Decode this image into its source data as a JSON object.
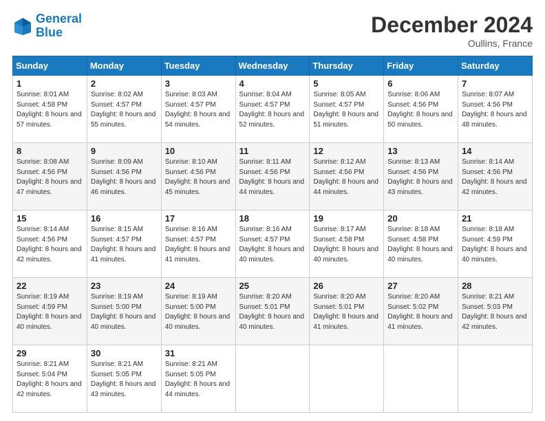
{
  "header": {
    "logo_line1": "General",
    "logo_line2": "Blue",
    "month": "December 2024",
    "location": "Oullins, France"
  },
  "weekdays": [
    "Sunday",
    "Monday",
    "Tuesday",
    "Wednesday",
    "Thursday",
    "Friday",
    "Saturday"
  ],
  "weeks": [
    [
      {
        "day": "1",
        "sunrise": "8:01 AM",
        "sunset": "4:58 PM",
        "daylight": "8 hours and 57 minutes."
      },
      {
        "day": "2",
        "sunrise": "8:02 AM",
        "sunset": "4:57 PM",
        "daylight": "8 hours and 55 minutes."
      },
      {
        "day": "3",
        "sunrise": "8:03 AM",
        "sunset": "4:57 PM",
        "daylight": "8 hours and 54 minutes."
      },
      {
        "day": "4",
        "sunrise": "8:04 AM",
        "sunset": "4:57 PM",
        "daylight": "8 hours and 52 minutes."
      },
      {
        "day": "5",
        "sunrise": "8:05 AM",
        "sunset": "4:57 PM",
        "daylight": "8 hours and 51 minutes."
      },
      {
        "day": "6",
        "sunrise": "8:06 AM",
        "sunset": "4:56 PM",
        "daylight": "8 hours and 50 minutes."
      },
      {
        "day": "7",
        "sunrise": "8:07 AM",
        "sunset": "4:56 PM",
        "daylight": "8 hours and 48 minutes."
      }
    ],
    [
      {
        "day": "8",
        "sunrise": "8:08 AM",
        "sunset": "4:56 PM",
        "daylight": "8 hours and 47 minutes."
      },
      {
        "day": "9",
        "sunrise": "8:09 AM",
        "sunset": "4:56 PM",
        "daylight": "8 hours and 46 minutes."
      },
      {
        "day": "10",
        "sunrise": "8:10 AM",
        "sunset": "4:56 PM",
        "daylight": "8 hours and 45 minutes."
      },
      {
        "day": "11",
        "sunrise": "8:11 AM",
        "sunset": "4:56 PM",
        "daylight": "8 hours and 44 minutes."
      },
      {
        "day": "12",
        "sunrise": "8:12 AM",
        "sunset": "4:56 PM",
        "daylight": "8 hours and 44 minutes."
      },
      {
        "day": "13",
        "sunrise": "8:13 AM",
        "sunset": "4:56 PM",
        "daylight": "8 hours and 43 minutes."
      },
      {
        "day": "14",
        "sunrise": "8:14 AM",
        "sunset": "4:56 PM",
        "daylight": "8 hours and 42 minutes."
      }
    ],
    [
      {
        "day": "15",
        "sunrise": "8:14 AM",
        "sunset": "4:56 PM",
        "daylight": "8 hours and 42 minutes."
      },
      {
        "day": "16",
        "sunrise": "8:15 AM",
        "sunset": "4:57 PM",
        "daylight": "8 hours and 41 minutes."
      },
      {
        "day": "17",
        "sunrise": "8:16 AM",
        "sunset": "4:57 PM",
        "daylight": "8 hours and 41 minutes."
      },
      {
        "day": "18",
        "sunrise": "8:16 AM",
        "sunset": "4:57 PM",
        "daylight": "8 hours and 40 minutes."
      },
      {
        "day": "19",
        "sunrise": "8:17 AM",
        "sunset": "4:58 PM",
        "daylight": "8 hours and 40 minutes."
      },
      {
        "day": "20",
        "sunrise": "8:18 AM",
        "sunset": "4:58 PM",
        "daylight": "8 hours and 40 minutes."
      },
      {
        "day": "21",
        "sunrise": "8:18 AM",
        "sunset": "4:59 PM",
        "daylight": "8 hours and 40 minutes."
      }
    ],
    [
      {
        "day": "22",
        "sunrise": "8:19 AM",
        "sunset": "4:59 PM",
        "daylight": "8 hours and 40 minutes."
      },
      {
        "day": "23",
        "sunrise": "8:19 AM",
        "sunset": "5:00 PM",
        "daylight": "8 hours and 40 minutes."
      },
      {
        "day": "24",
        "sunrise": "8:19 AM",
        "sunset": "5:00 PM",
        "daylight": "8 hours and 40 minutes."
      },
      {
        "day": "25",
        "sunrise": "8:20 AM",
        "sunset": "5:01 PM",
        "daylight": "8 hours and 40 minutes."
      },
      {
        "day": "26",
        "sunrise": "8:20 AM",
        "sunset": "5:01 PM",
        "daylight": "8 hours and 41 minutes."
      },
      {
        "day": "27",
        "sunrise": "8:20 AM",
        "sunset": "5:02 PM",
        "daylight": "8 hours and 41 minutes."
      },
      {
        "day": "28",
        "sunrise": "8:21 AM",
        "sunset": "5:03 PM",
        "daylight": "8 hours and 42 minutes."
      }
    ],
    [
      {
        "day": "29",
        "sunrise": "8:21 AM",
        "sunset": "5:04 PM",
        "daylight": "8 hours and 42 minutes."
      },
      {
        "day": "30",
        "sunrise": "8:21 AM",
        "sunset": "5:05 PM",
        "daylight": "8 hours and 43 minutes."
      },
      {
        "day": "31",
        "sunrise": "8:21 AM",
        "sunset": "5:05 PM",
        "daylight": "8 hours and 44 minutes."
      },
      null,
      null,
      null,
      null
    ]
  ]
}
